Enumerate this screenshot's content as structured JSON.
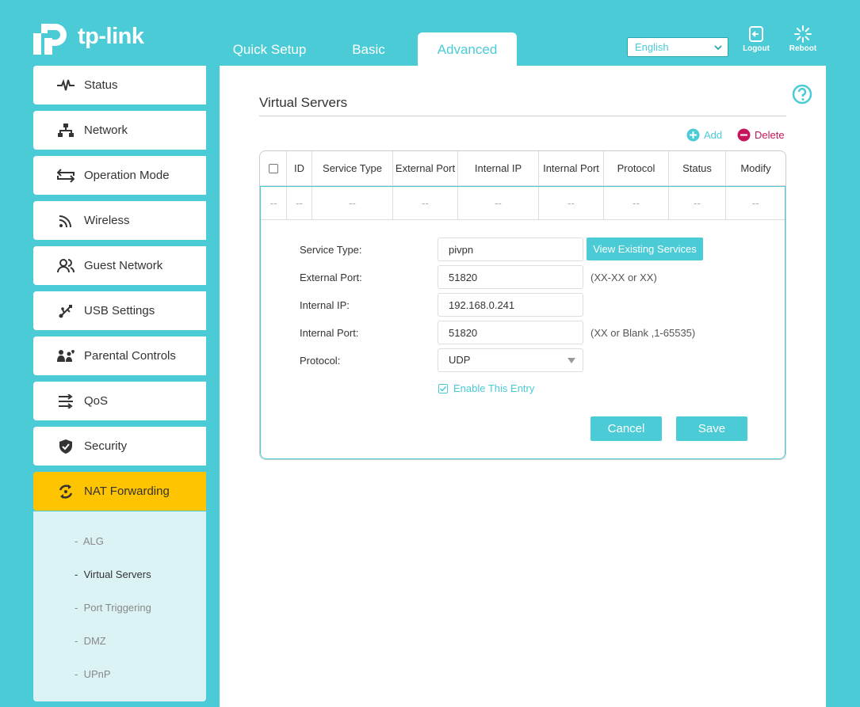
{
  "brand": {
    "name": "tp-link"
  },
  "nav": {
    "tabs": [
      {
        "label": "Quick Setup"
      },
      {
        "label": "Basic"
      },
      {
        "label": "Advanced"
      }
    ]
  },
  "header": {
    "language": "English",
    "logout_label": "Logout",
    "reboot_label": "Reboot"
  },
  "sidebar": {
    "items": [
      {
        "label": "Status",
        "icon": "pulse-icon"
      },
      {
        "label": "Network",
        "icon": "network-icon"
      },
      {
        "label": "Operation Mode",
        "icon": "swap-icon"
      },
      {
        "label": "Wireless",
        "icon": "wifi-icon"
      },
      {
        "label": "Guest Network",
        "icon": "guest-icon"
      },
      {
        "label": "USB Settings",
        "icon": "usb-icon"
      },
      {
        "label": "Parental Controls",
        "icon": "family-icon"
      },
      {
        "label": "QoS",
        "icon": "qos-icon"
      },
      {
        "label": "Security",
        "icon": "shield-icon"
      },
      {
        "label": "NAT Forwarding",
        "icon": "nat-icon"
      }
    ],
    "subitems": [
      {
        "label": "ALG"
      },
      {
        "label": "Virtual Servers"
      },
      {
        "label": "Port Triggering"
      },
      {
        "label": "DMZ"
      },
      {
        "label": "UPnP"
      }
    ],
    "sub_prefix": "-"
  },
  "main": {
    "title": "Virtual Servers",
    "add_label": "Add",
    "delete_label": "Delete",
    "table": {
      "headers": [
        "ID",
        "Service Type",
        "External Port",
        "Internal IP",
        "Internal Port",
        "Protocol",
        "Status",
        "Modify"
      ],
      "empty_row": [
        "--",
        "--",
        "--",
        "--",
        "--",
        "--",
        "--",
        "--",
        "--"
      ]
    },
    "form": {
      "service_type_label": "Service Type:",
      "service_type_value": "pivpn",
      "view_services_label": "View Existing Services",
      "external_port_label": "External Port:",
      "external_port_value": "51820",
      "external_port_hint": "(XX-XX or XX)",
      "internal_ip_label": "Internal IP:",
      "internal_ip_value": "192.168.0.241",
      "internal_port_label": "Internal Port:",
      "internal_port_value": "51820",
      "internal_port_hint": "(XX or Blank ,1-65535)",
      "protocol_label": "Protocol:",
      "protocol_value": "UDP",
      "enable_label": "Enable This Entry",
      "cancel_label": "Cancel",
      "save_label": "Save"
    }
  },
  "colors": {
    "accent": "#4acbd6",
    "active_nav": "#ffc400",
    "delete": "#c4155c"
  }
}
